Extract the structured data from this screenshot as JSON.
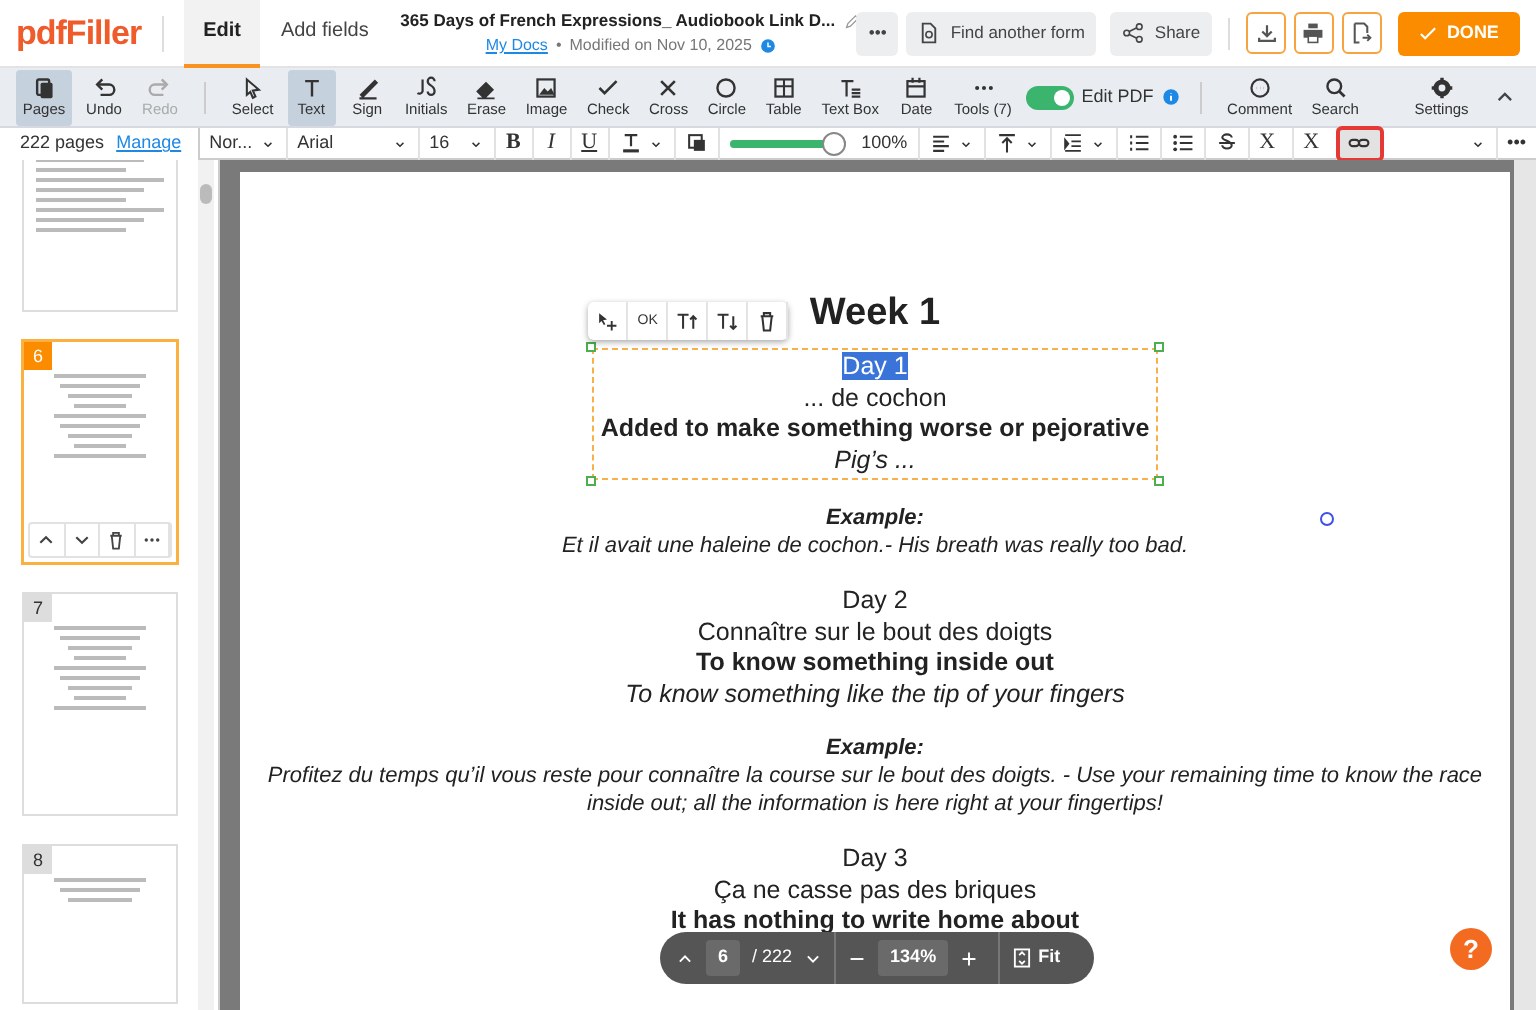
{
  "header": {
    "logo": "pdfFiller",
    "tabs": [
      {
        "label": "Edit",
        "selected": true
      },
      {
        "label": "Add fields",
        "selected": false
      }
    ],
    "title": "365 Days of French Expressions_ Audiobook Link D...",
    "folder": "My Docs",
    "separator": "•",
    "modified": "Modified on Nov 10, 2025",
    "more": "•••",
    "find": "Find another form",
    "share": "Share",
    "done": "DONE"
  },
  "tools": [
    {
      "kind": "pages",
      "label": "Pages",
      "selected": true,
      "disabled": false
    },
    {
      "kind": "undo",
      "label": "Undo",
      "selected": false,
      "disabled": false
    },
    {
      "kind": "redo",
      "label": "Redo",
      "selected": false,
      "disabled": true
    },
    {
      "kind": "select",
      "label": "Select",
      "selected": false,
      "disabled": false
    },
    {
      "kind": "text",
      "label": "Text",
      "selected": true,
      "disabled": false
    },
    {
      "kind": "sign",
      "label": "Sign",
      "selected": false,
      "disabled": false
    },
    {
      "kind": "initials",
      "label": "Initials",
      "selected": false,
      "disabled": false
    },
    {
      "kind": "erase",
      "label": "Erase",
      "selected": false,
      "disabled": false
    },
    {
      "kind": "image",
      "label": "Image",
      "selected": false,
      "disabled": false
    },
    {
      "kind": "check",
      "label": "Check",
      "selected": false,
      "disabled": false
    },
    {
      "kind": "cross",
      "label": "Cross",
      "selected": false,
      "disabled": false
    },
    {
      "kind": "circle",
      "label": "Circle",
      "selected": false,
      "disabled": false
    },
    {
      "kind": "table",
      "label": "Table",
      "selected": false,
      "disabled": false
    },
    {
      "kind": "textbox",
      "label": "Text Box",
      "selected": false,
      "disabled": false
    },
    {
      "kind": "date",
      "label": "Date",
      "selected": false,
      "disabled": false
    },
    {
      "kind": "more",
      "label": "Tools (7)",
      "selected": false,
      "disabled": false
    }
  ],
  "edit_pdf": {
    "label": "Edit PDF",
    "on": true
  },
  "right_tools": [
    {
      "kind": "comment",
      "label": "Comment"
    },
    {
      "kind": "search",
      "label": "Search"
    },
    {
      "kind": "settings",
      "label": "Settings"
    }
  ],
  "pages_panel": {
    "count": "222 pages",
    "manage": "Manage",
    "thumbnails": [
      {
        "kind": "partial",
        "selected": false
      },
      {
        "kind": "page",
        "number": "6",
        "selected": true
      },
      {
        "kind": "page",
        "number": "7",
        "selected": false
      },
      {
        "kind": "page",
        "number": "8",
        "selected": false
      }
    ]
  },
  "format_bar": {
    "style": "Nor...",
    "font": "Arial",
    "size": "16",
    "opacity": {
      "level": 1
    },
    "opacity_reading": "100%",
    "more": "•••",
    "buttons": [
      {
        "kind": "bold",
        "label": "B",
        "selected": false
      },
      {
        "kind": "italic",
        "label": "I",
        "selected": false
      },
      {
        "kind": "underline",
        "label": "U",
        "selected": false
      },
      {
        "kind": "color",
        "selected": false
      },
      {
        "kind": "opacity",
        "selected": false
      }
    ],
    "buttons2": [
      {
        "kind": "align",
        "selected": false
      },
      {
        "kind": "valign",
        "selected": false
      },
      {
        "kind": "indent",
        "selected": false
      },
      {
        "kind": "numbered",
        "selected": false
      },
      {
        "kind": "bullets",
        "selected": false
      },
      {
        "kind": "strike",
        "selected": false
      },
      {
        "kind": "superscript",
        "label": "X",
        "selected": false
      },
      {
        "kind": "subscript",
        "label": "X",
        "selected": false
      },
      {
        "kind": "link",
        "selected": true
      }
    ]
  },
  "text_toolbar": [
    {
      "kind": "move"
    },
    {
      "kind": "ok",
      "label": "OK"
    },
    {
      "kind": "grow"
    },
    {
      "kind": "shrink"
    },
    {
      "kind": "delete"
    }
  ],
  "document": {
    "lines": [
      {
        "kind": "title",
        "text": "Week 1"
      },
      {
        "kind": "group",
        "selected": true,
        "lines": [
          {
            "kind": "day",
            "text": "Day 1",
            "highlighted": true
          },
          {
            "kind": "french",
            "text": "... de cochon"
          },
          {
            "kind": "meaning",
            "text": "Added to make something worse or pejorative"
          },
          {
            "kind": "literal",
            "text": "Pig’s ..."
          }
        ]
      },
      {
        "kind": "example_label",
        "text": "Example:"
      },
      {
        "kind": "example",
        "text": "Et il avait une haleine de cochon.- His breath was really too bad."
      },
      {
        "kind": "day",
        "text": "Day 2"
      },
      {
        "kind": "french",
        "text": "Connaître sur le bout des doigts"
      },
      {
        "kind": "meaning",
        "text": "To know something inside out"
      },
      {
        "kind": "literal",
        "text": "To know something like the tip of your fingers"
      },
      {
        "kind": "example_label",
        "text": "Example:"
      },
      {
        "kind": "example",
        "text": "Profitez du temps qu’il vous reste pour connaître la course sur le bout des doigts. - Use your remaining time to know the race inside out; all the information is here right at your fingertips!"
      },
      {
        "kind": "day",
        "text": "Day 3"
      },
      {
        "kind": "french",
        "text": "Ça ne casse pas des briques"
      },
      {
        "kind": "meaning",
        "text": "It has nothing to write home about"
      }
    ]
  },
  "navigator": {
    "page": "6",
    "total": "/ 222",
    "zoom": "134%",
    "fit": "Fit"
  },
  "help": "?"
}
